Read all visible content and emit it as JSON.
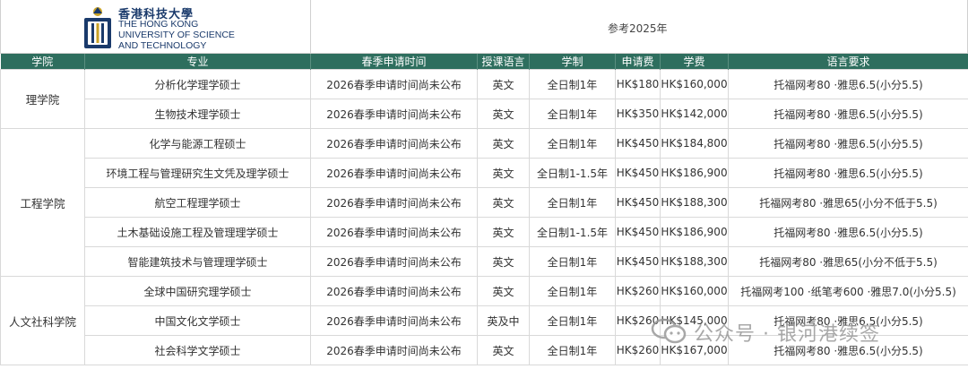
{
  "header": {
    "logo_cn": "香港科技大學",
    "logo_en": [
      "THE HONG KONG",
      "UNIVERSITY OF SCIENCE",
      "AND TECHNOLOGY"
    ],
    "ref_year": "参考2025年"
  },
  "columns": [
    "学院",
    "专业",
    "春季申请时间",
    "授课语言",
    "学制",
    "申请费",
    "学费",
    "语言要求"
  ],
  "colleges": [
    {
      "name": "理学院",
      "rows": [
        [
          "分析化学理学硕士",
          "2026春季申请时间尚未公布",
          "英文",
          "全日制1年",
          "HK$180",
          "HK$160,000",
          "托福网考80 ·雅思6.5(小分5.5)"
        ],
        [
          "生物技术理学硕士",
          "2026春季申请时间尚未公布",
          "英文",
          "全日制1年",
          "HK$350",
          "HK$142,000",
          "托福网考80 ·雅思6.5(小分5.5)"
        ]
      ]
    },
    {
      "name": "工程学院",
      "rows": [
        [
          "化学与能源工程硕士",
          "2026春季申请时间尚未公布",
          "英文",
          "全日制1年",
          "HK$450",
          "HK$184,800",
          "托福网考80 ·雅思6.5(小分5.5)"
        ],
        [
          "环境工程与管理研究生文凭及理学硕士",
          "2026春季申请时间尚未公布",
          "英文",
          "全日制1-1.5年",
          "HK$450",
          "HK$186,900",
          "托福网考80 ·雅思6.5(小分5.5)"
        ],
        [
          "航空工程理学硕士",
          "2026春季申请时间尚未公布",
          "英文",
          "全日制1年",
          "HK$450",
          "HK$188,300",
          "托福网考80 ·雅思65(小分不低于5.5)"
        ],
        [
          "土木基础设施工程及管理理学硕士",
          "2026春季申请时间尚未公布",
          "英文",
          "全日制1-1.5年",
          "HK$450",
          "HK$186,900",
          "托福网考80 ·雅思6.5(小分5.5)"
        ],
        [
          "智能建筑技术与管理理学硕士",
          "2026春季申请时间尚未公布",
          "英文",
          "全日制1年",
          "HK$450",
          "HK$188,300",
          "托福网考80 ·雅思65(小分不低于5.5)"
        ]
      ]
    },
    {
      "name": "人文社科学院",
      "rows": [
        [
          "全球中国研究理学硕士",
          "2026春季申请时间尚未公布",
          "英文",
          "全日制1年",
          "HK$260",
          "HK$160,000",
          "托福网考100 ·纸笔考600 ·雅思7.0(小分5.5)"
        ],
        [
          "中国文化文学硕士",
          "2026春季申请时间尚未公布",
          "英及中",
          "全日制1年",
          "HK$260",
          "HK$145,000",
          "托福网考80 ·雅思6.5(小分5.5)"
        ],
        [
          "社会科学文学硕士",
          "2026春季申请时间尚未公布",
          "英文",
          "全日制1年",
          "HK$260",
          "HK$167,000",
          "托福网考80 ·雅思6.5(小分5.5)"
        ]
      ]
    }
  ],
  "watermark": "公众号 · 银河港续签",
  "colors": {
    "header_bg": "#2e6e5e",
    "logo": "#1a3a6b",
    "border": "#d9d9d9"
  }
}
